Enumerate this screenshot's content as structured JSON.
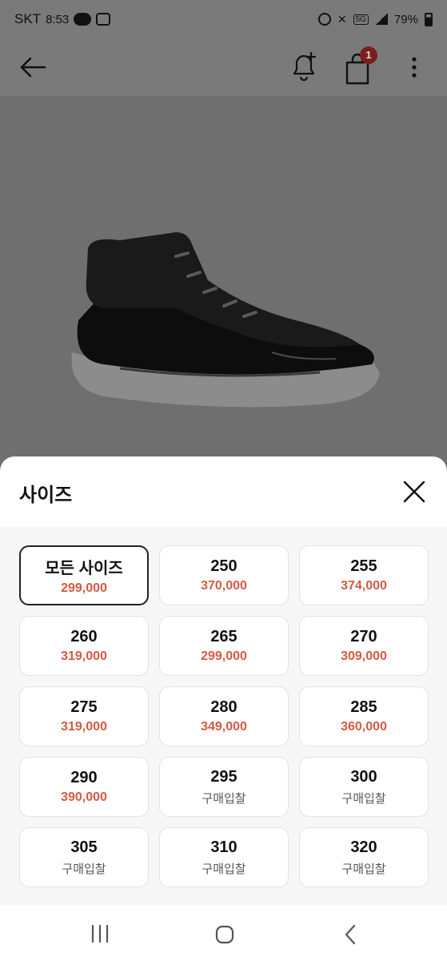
{
  "status_bar": {
    "carrier": "SKT",
    "time": "8:53",
    "network": "5G",
    "battery": "79%"
  },
  "app_bar": {
    "cart_count": "1"
  },
  "sheet": {
    "title": "사이즈",
    "sizes": [
      {
        "label": "모든 사이즈",
        "price": "299,000"
      },
      {
        "label": "250",
        "price": "370,000"
      },
      {
        "label": "255",
        "price": "374,000"
      },
      {
        "label": "260",
        "price": "319,000"
      },
      {
        "label": "265",
        "price": "299,000"
      },
      {
        "label": "270",
        "price": "309,000"
      },
      {
        "label": "275",
        "price": "319,000"
      },
      {
        "label": "280",
        "price": "349,000"
      },
      {
        "label": "285",
        "price": "360,000"
      },
      {
        "label": "290",
        "price": "390,000"
      },
      {
        "label": "295",
        "price": "구매입찰"
      },
      {
        "label": "300",
        "price": "구매입찰"
      },
      {
        "label": "305",
        "price": "구매입찰"
      },
      {
        "label": "310",
        "price": "구매입찰"
      },
      {
        "label": "320",
        "price": "구매입찰"
      }
    ]
  },
  "icons": {
    "back": "arrow-left-icon",
    "alarm": "bell-plus-icon",
    "cart": "shopping-bag-icon",
    "more": "more-vertical-icon",
    "close": "close-icon"
  },
  "colors": {
    "price": "#d45a42",
    "badge": "#7b1d1d",
    "overlay": "#7a7a7a"
  }
}
